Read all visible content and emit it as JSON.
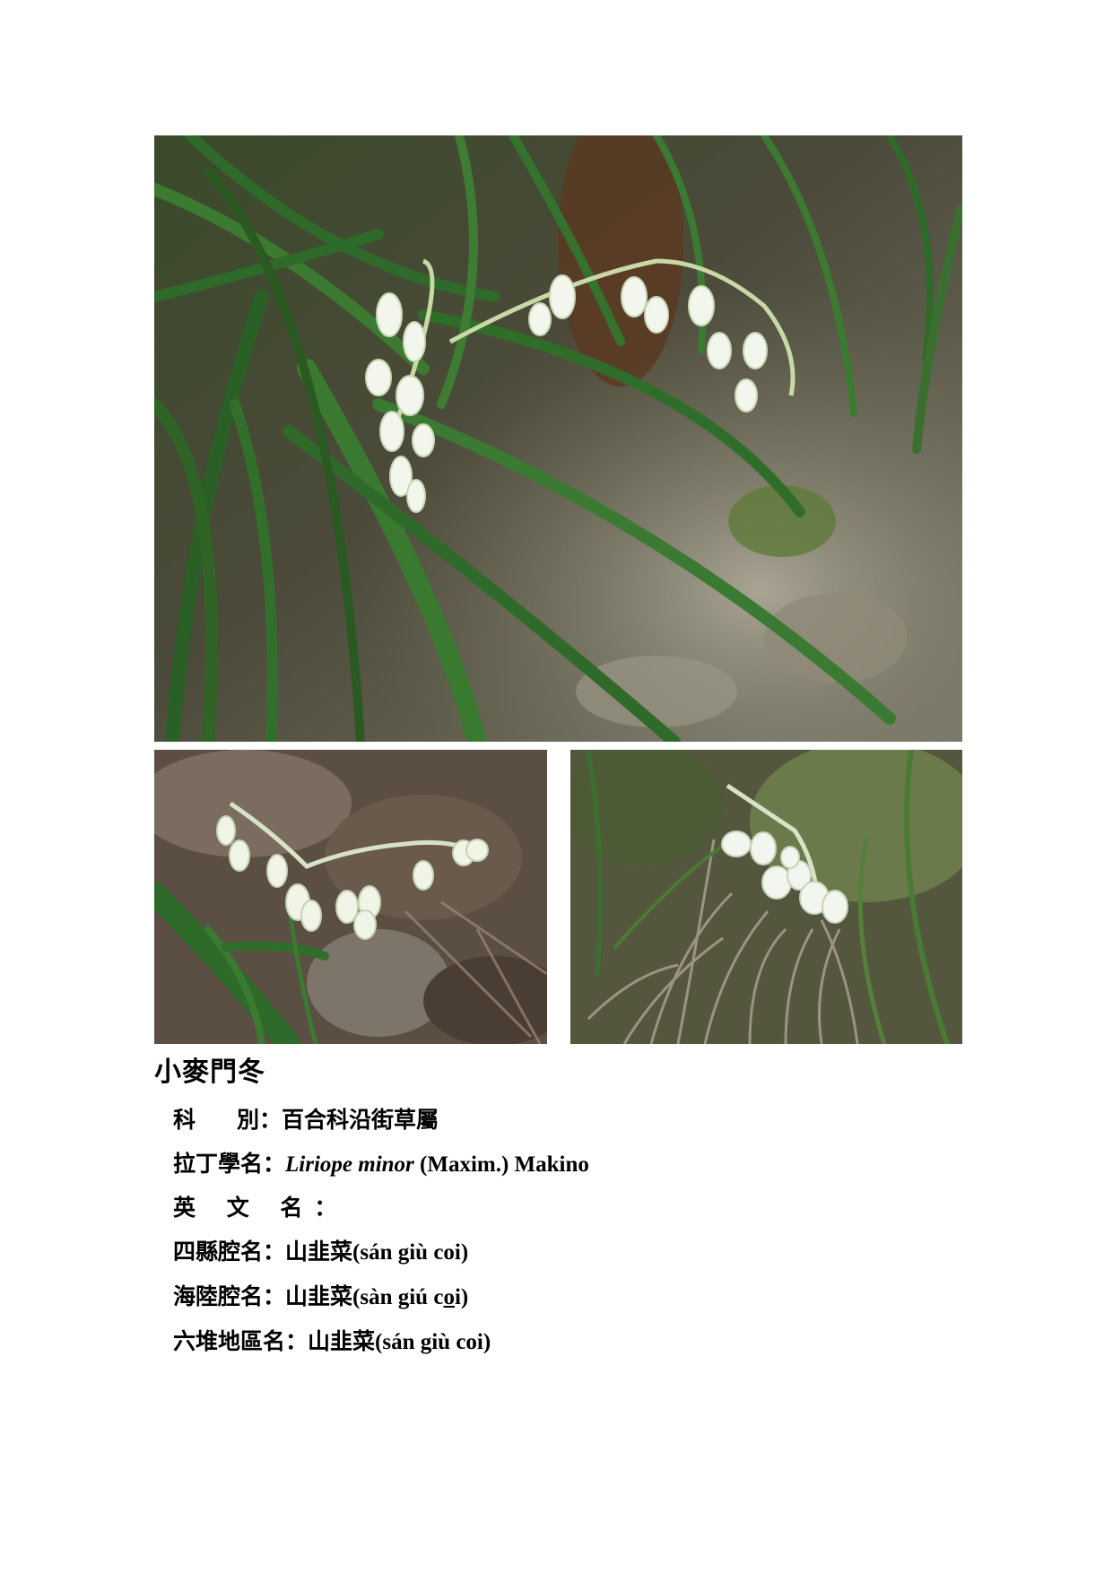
{
  "title": "小麥門冬",
  "fields": {
    "family": {
      "label_a": "科",
      "label_b": "別：",
      "value": "百合科沿街草屬"
    },
    "latin": {
      "label": "拉丁學名：",
      "genus_species": "Liriope minor",
      "authority": "(Maxim.) Makino"
    },
    "english": {
      "label": "英 文 名：",
      "value": ""
    },
    "sixian": {
      "label": "四縣腔名：",
      "cjk": "山韭菜",
      "romanization": "(sán giù coi)"
    },
    "hailu": {
      "label": "海陸腔名：",
      "cjk": "山韭菜",
      "rom_pre": "(sàn giú c",
      "rom_ul": "o",
      "rom_post": "i)"
    },
    "liudui": {
      "label": "六堆地區名：",
      "cjk": "山韭菜",
      "romanization": "(sán giù coi)"
    }
  },
  "photos": [
    {
      "name": "main-photo",
      "subject": "Liriope minor plant with white flower spikes among grass leaves"
    },
    {
      "name": "left-photo",
      "subject": "white flower raceme over dry leaves"
    },
    {
      "name": "right-photo",
      "subject": "white flowers among dry grass"
    }
  ]
}
